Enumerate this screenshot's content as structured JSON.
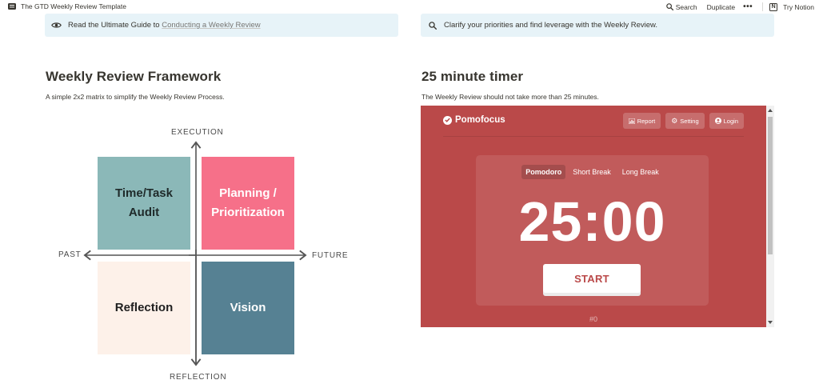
{
  "topbar": {
    "page_title": "The GTD Weekly Review Template",
    "search_label": "Search",
    "duplicate_label": "Duplicate",
    "more_label": "•••",
    "try_label": "Try Notion"
  },
  "callouts": {
    "left": {
      "text": "Read the Ultimate Guide to ",
      "link": "Conducting a Weekly Review",
      "icon": "eye-icon"
    },
    "right": {
      "text": "Clarify your priorities and find leverage with the Weekly Review.",
      "icon": "search-icon"
    }
  },
  "framework": {
    "title": "Weekly Review Framework",
    "subtitle": "A simple 2x2 matrix to simplify the Weekly Review Process.",
    "axes": {
      "top": "EXECUTION",
      "bottom": "REFLECTION",
      "left": "PAST",
      "right": "FUTURE"
    },
    "quadrants": [
      {
        "line1": "Time/Task",
        "line2": "Audit",
        "color": "#8bb8b8",
        "text_color": "#1f2a2a"
      },
      {
        "line1": "Planning /",
        "line2": "Prioritization",
        "color": "#f67089",
        "text_color": "#ffffff"
      },
      {
        "line1": "Reflection",
        "line2": "",
        "color": "#fdf1e9",
        "text_color": "#1f1f1f"
      },
      {
        "line1": "Vision",
        "line2": "",
        "color": "#568193",
        "text_color": "#ffffff"
      }
    ]
  },
  "timer": {
    "title": "25 minute timer",
    "subtitle": "The Weekly Review should not take more than 25 minutes.",
    "app": {
      "brand": "Pomofocus",
      "nav": [
        "Report",
        "Setting",
        "Login"
      ],
      "tabs": [
        "Pomodoro",
        "Short Break",
        "Long Break"
      ],
      "active_tab": "Pomodoro",
      "time": "25:00",
      "start_label": "START",
      "count": "#0",
      "bg_color": "#ba4949"
    }
  }
}
